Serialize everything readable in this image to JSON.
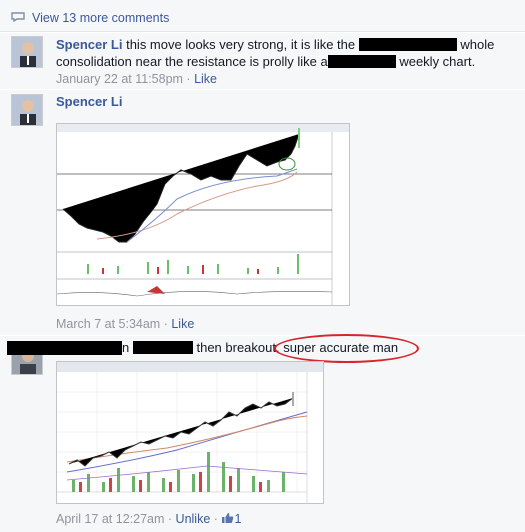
{
  "view_more": {
    "label": "View 13 more comments",
    "icon": "comment-bubble-icon"
  },
  "comments": [
    {
      "author": "Spencer Li",
      "text_before": "this move looks very strong, it is like the",
      "text_middle": "whole consolidation near the resistance is prolly like a",
      "text_end": "weekly chart.",
      "timestamp": "January 22 at 11:58pm",
      "like_label": "Like"
    },
    {
      "author": "Spencer Li",
      "timestamp": "March 7 at 5:34am",
      "like_label": "Like"
    },
    {
      "text_n": "n",
      "text_breakout": "then breakout.",
      "text_highlight": "super accurate man",
      "timestamp": "April 17 at 12:27am",
      "unlike_label": "Unlike",
      "like_count": "1"
    }
  ],
  "separator": "·",
  "colors": {
    "link": "#3b5998",
    "meta": "#90949c",
    "highlight": "#d9252a",
    "bg": "#f6f7f9"
  }
}
